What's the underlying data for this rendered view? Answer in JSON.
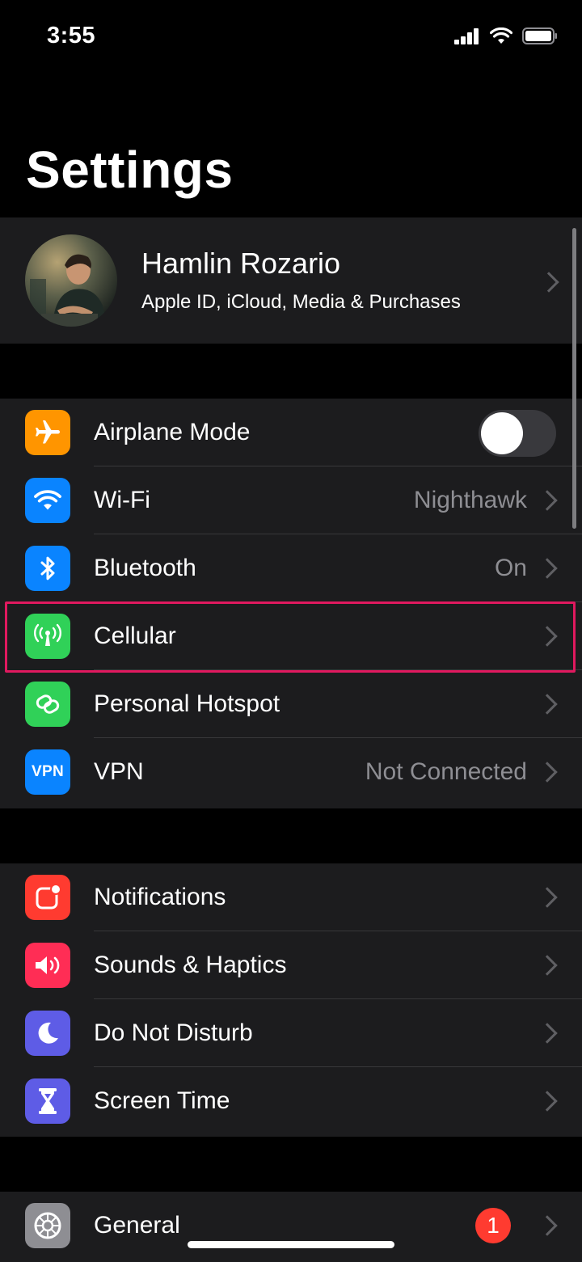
{
  "status_bar": {
    "time": "3:55"
  },
  "title": "Settings",
  "profile": {
    "name": "Hamlin Rozario",
    "subtitle": "Apple ID, iCloud, Media & Purchases"
  },
  "connectivity": [
    {
      "label": "Airplane Mode",
      "icon": "airplane-icon",
      "color": "#ff9500"
    },
    {
      "label": "Wi-Fi",
      "value": "Nighthawk",
      "icon": "wifi-icon",
      "color": "#0a84ff"
    },
    {
      "label": "Bluetooth",
      "value": "On",
      "icon": "bluetooth-icon",
      "color": "#0a84ff"
    },
    {
      "label": "Cellular",
      "icon": "cellular-antenna-icon",
      "color": "#30d158"
    },
    {
      "label": "Personal Hotspot",
      "icon": "hotspot-link-icon",
      "color": "#30d158"
    },
    {
      "label": "VPN",
      "value": "Not Connected",
      "icon": "vpn-icon",
      "color": "#0a84ff",
      "icon_text": "VPN"
    }
  ],
  "alerts": [
    {
      "label": "Notifications",
      "icon": "notifications-icon",
      "color": "#ff3b30"
    },
    {
      "label": "Sounds & Haptics",
      "icon": "speaker-icon",
      "color": "#ff2d55"
    },
    {
      "label": "Do Not Disturb",
      "icon": "moon-icon",
      "color": "#5e5ce6"
    },
    {
      "label": "Screen Time",
      "icon": "hourglass-icon",
      "color": "#5e5ce6"
    }
  ],
  "system": [
    {
      "label": "General",
      "badge": "1",
      "icon": "gear-icon",
      "color": "#8e8e93"
    }
  ],
  "airplane_mode_on": false,
  "accent_highlight": "#e0195f"
}
